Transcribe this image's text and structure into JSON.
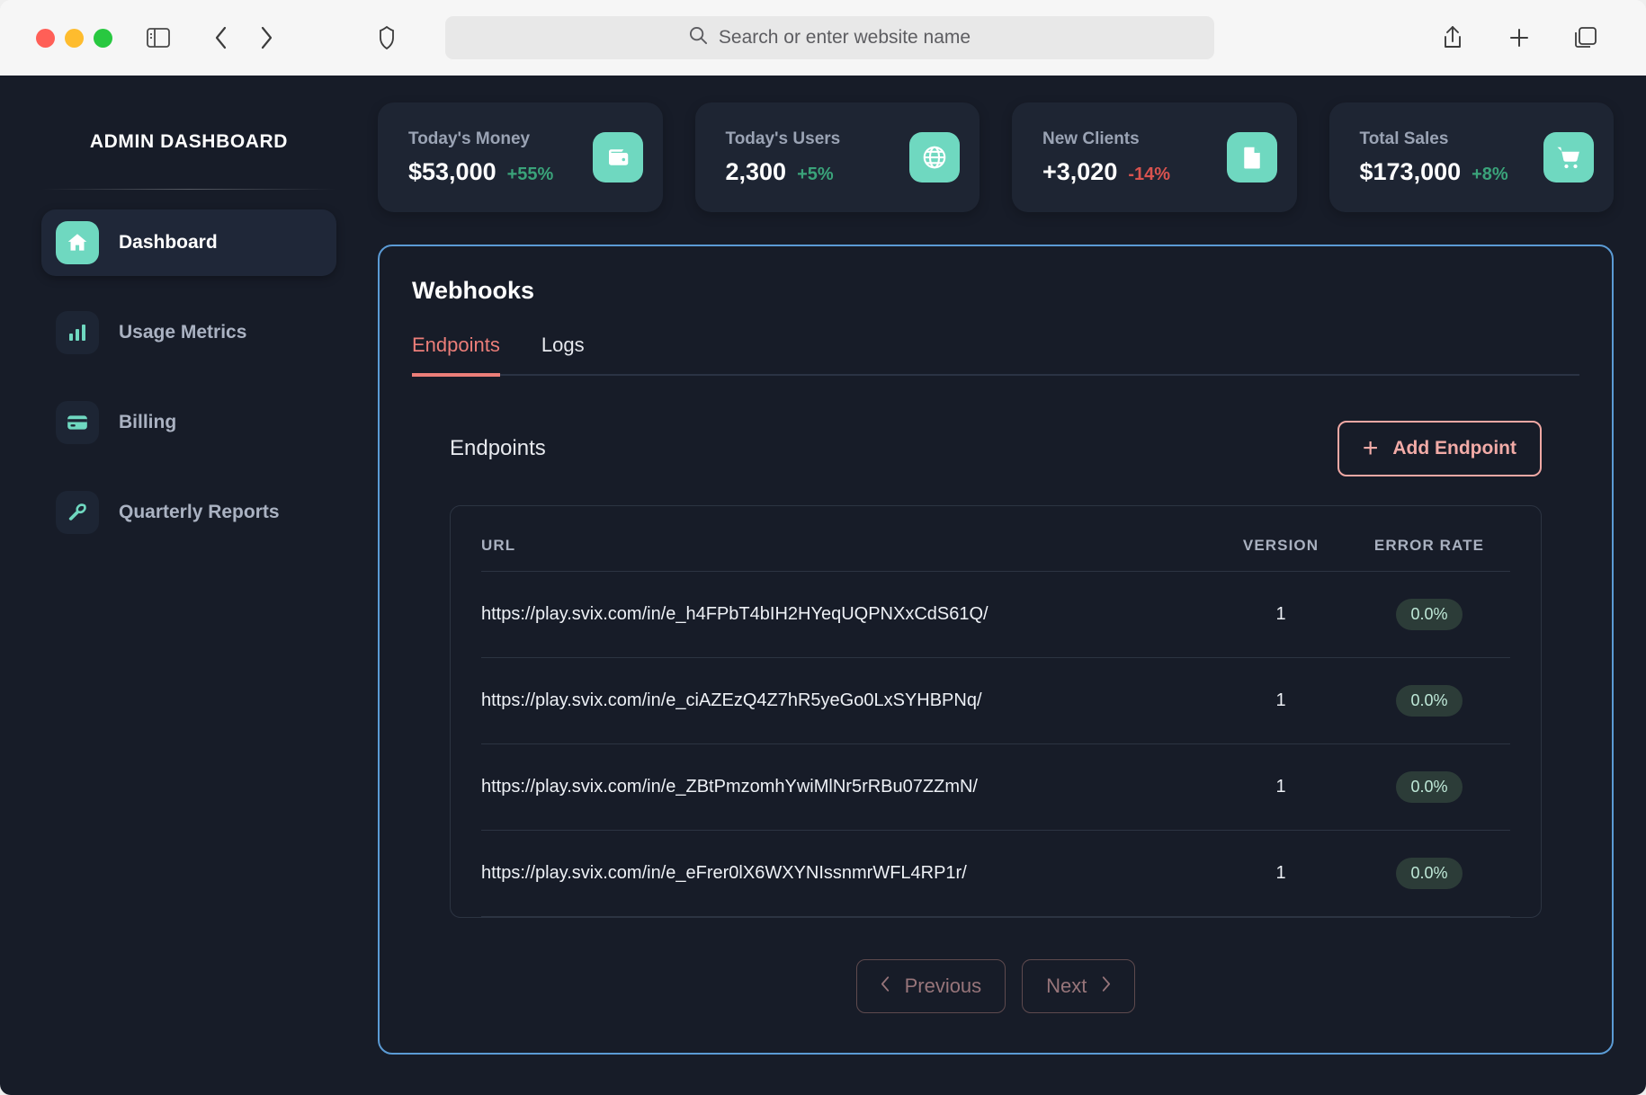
{
  "browser": {
    "url_placeholder": "Search or enter website name",
    "icons": {
      "sidebar_toggle": "sidebar-toggle-icon",
      "back": "chevron-left-icon",
      "forward": "chevron-right-icon",
      "shield": "shield-icon",
      "search": "search-icon",
      "share": "share-icon",
      "new_tab": "plus-icon",
      "tabs": "tab-overview-icon"
    }
  },
  "sidebar": {
    "brand": "ADMIN DASHBOARD",
    "items": [
      {
        "label": "Dashboard",
        "icon": "home-icon",
        "active": true
      },
      {
        "label": "Usage Metrics",
        "icon": "chart-icon",
        "active": false
      },
      {
        "label": "Billing",
        "icon": "credit-card-icon",
        "active": false
      },
      {
        "label": "Quarterly Reports",
        "icon": "wrench-icon",
        "active": false
      }
    ]
  },
  "stats": [
    {
      "title": "Today's Money",
      "value": "$53,000",
      "delta": "+55%",
      "direction": "up",
      "icon": "wallet-icon"
    },
    {
      "title": "Today's Users",
      "value": "2,300",
      "delta": "+5%",
      "direction": "up",
      "icon": "globe-icon"
    },
    {
      "title": "New Clients",
      "value": "+3,020",
      "delta": "-14%",
      "direction": "down",
      "icon": "document-icon"
    },
    {
      "title": "Total Sales",
      "value": "$173,000",
      "delta": "+8%",
      "direction": "up",
      "icon": "cart-icon"
    }
  ],
  "panel": {
    "title": "Webhooks",
    "tabs": [
      {
        "label": "Endpoints",
        "active": true
      },
      {
        "label": "Logs",
        "active": false
      }
    ],
    "section_title": "Endpoints",
    "add_button": {
      "label": "Add Endpoint",
      "icon": "plus-icon"
    },
    "table": {
      "columns": [
        "URL",
        "VERSION",
        "ERROR RATE"
      ],
      "rows": [
        {
          "url": "https://play.svix.com/in/e_h4FPbT4bIH2HYeqUQPNXxCdS61Q/",
          "version": "1",
          "error_rate": "0.0%"
        },
        {
          "url": "https://play.svix.com/in/e_ciAZEzQ4Z7hR5yeGo0LxSYHBPNq/",
          "version": "1",
          "error_rate": "0.0%"
        },
        {
          "url": "https://play.svix.com/in/e_ZBtPmzomhYwiMlNr5rRBu07ZZmN/",
          "version": "1",
          "error_rate": "0.0%"
        },
        {
          "url": "https://play.svix.com/in/e_eFrer0lX6WXYNIssnmrWFL4RP1r/",
          "version": "1",
          "error_rate": "0.0%"
        }
      ]
    },
    "pagination": {
      "previous": "Previous",
      "next": "Next",
      "prev_icon": "chevron-left-icon",
      "next_icon": "chevron-right-icon"
    }
  },
  "colors": {
    "page_bg": "#171c28",
    "card_bg": "#1e2533",
    "accent_teal": "#6fd8c0",
    "accent_coral": "#ec7e79",
    "focus_blue": "#5b9bd5",
    "positive": "#3aa37a",
    "negative": "#d9534f"
  }
}
